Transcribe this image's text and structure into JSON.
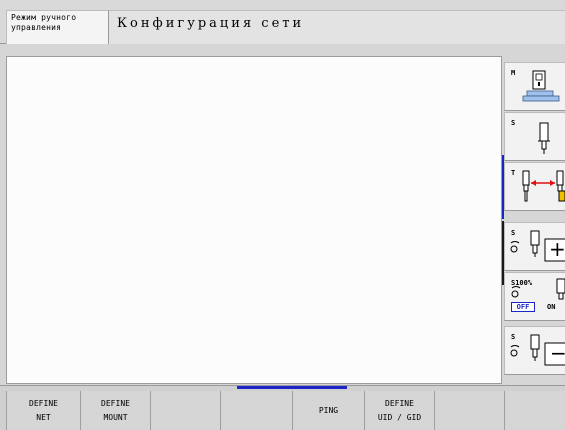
{
  "header": {
    "mode_line1": "Режим ручного",
    "mode_line2": "управления",
    "title": "Конфигурация сети"
  },
  "sidebar": {
    "m_label": "M",
    "s_label": "S",
    "t_label": "T",
    "s_plus_label": "S",
    "s100_label": "S100%",
    "off_label": "OFF",
    "on_label": "ON",
    "s_minus_label": "S",
    "plus_symbol": "+",
    "minus_symbol": "−",
    "arrow_color": "#e01010",
    "active_color": "#1c25c8"
  },
  "softkeys": [
    {
      "line1": "DEFINE",
      "line2": "NET"
    },
    {
      "line1": "DEFINE",
      "line2": "MOUNT"
    },
    {
      "line1": "",
      "line2": ""
    },
    {
      "line1": "",
      "line2": ""
    },
    {
      "line1": "PING",
      "line2": ""
    },
    {
      "line1": "DEFINE",
      "line2": "UID / GID"
    },
    {
      "line1": "",
      "line2": ""
    },
    {
      "line1": "",
      "line2": ""
    }
  ]
}
